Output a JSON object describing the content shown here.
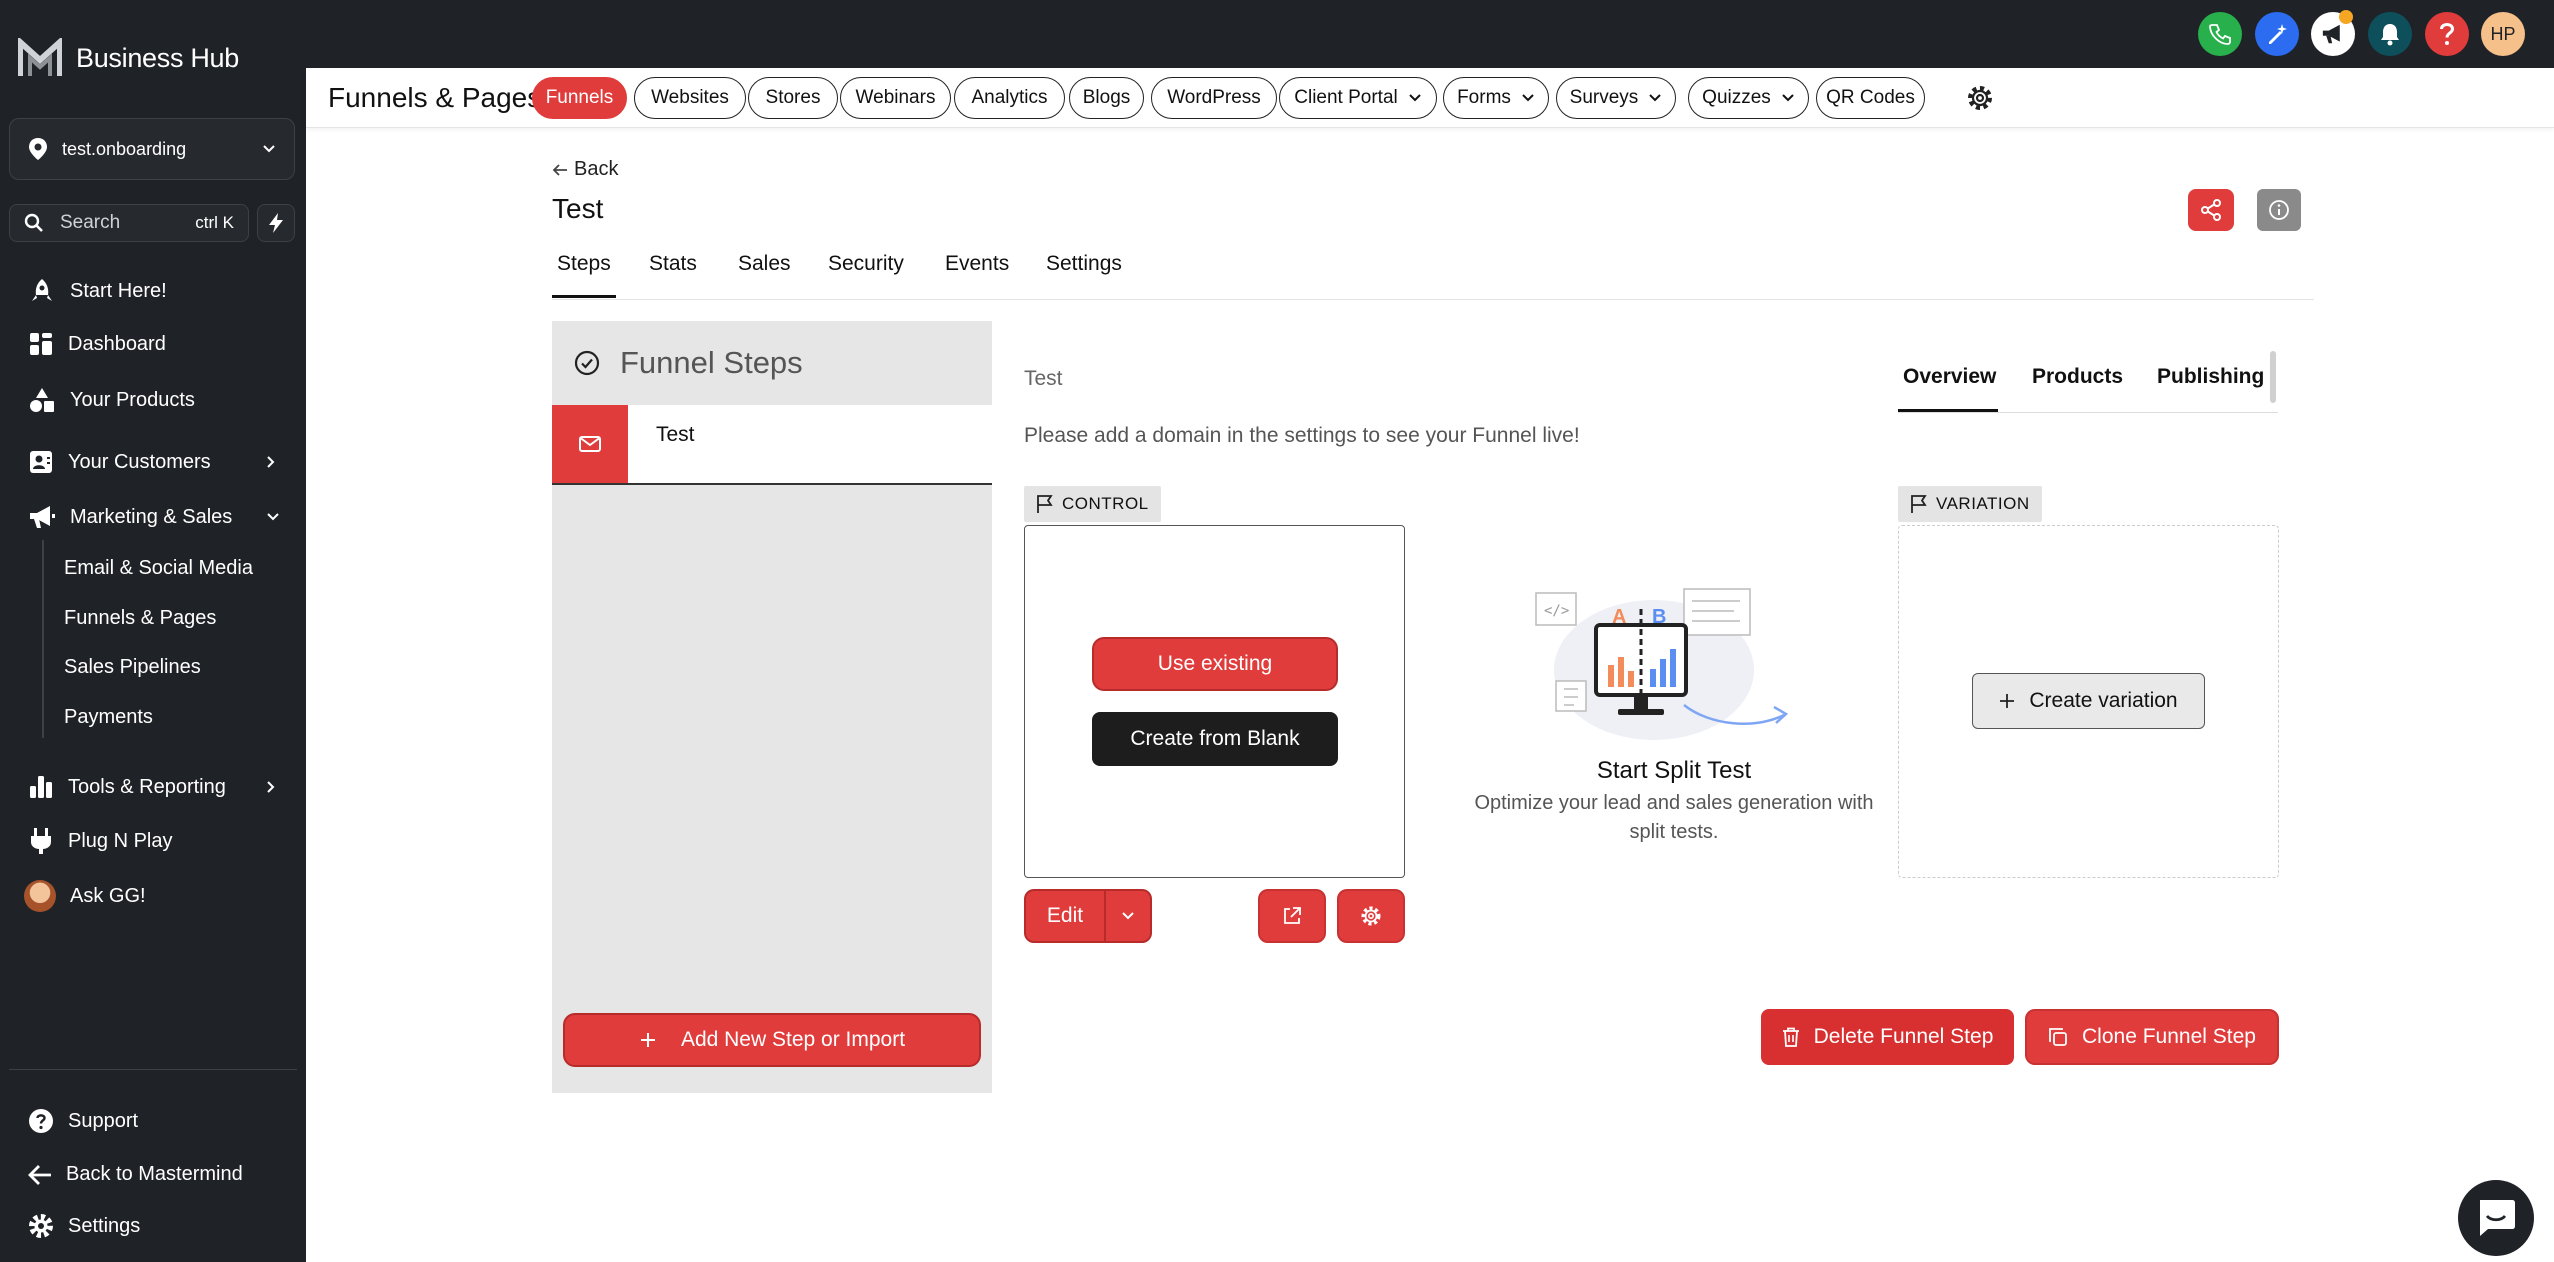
{
  "app": {
    "name": "Business Hub"
  },
  "account": {
    "name": "test.onboarding"
  },
  "search": {
    "placeholder": "Search",
    "shortcut": "ctrl K"
  },
  "sidebar": {
    "items": [
      {
        "label": "Start Here!",
        "icon": "rocket-icon"
      },
      {
        "label": "Dashboard",
        "icon": "dashboard-icon"
      },
      {
        "label": "Your Products",
        "icon": "shapes-icon"
      },
      {
        "label": "Your Customers",
        "icon": "contacts-icon"
      },
      {
        "label": "Marketing & Sales",
        "icon": "megaphone-icon"
      },
      {
        "label": "Tools & Reporting",
        "icon": "bar-chart-icon"
      },
      {
        "label": "Plug N Play",
        "icon": "plug-icon"
      },
      {
        "label": "Ask GG!",
        "icon": "avatar"
      }
    ],
    "sub_items": [
      "Email & Social Media",
      "Funnels & Pages",
      "Sales Pipelines",
      "Payments"
    ],
    "footer": [
      "Support",
      "Back to Mastermind",
      "Settings"
    ]
  },
  "topbar": {
    "user_initials": "HP",
    "accent": "#e03c3c"
  },
  "section": {
    "title": "Funnels & Pages",
    "tabs": [
      "Funnels",
      "Websites",
      "Stores",
      "Webinars",
      "Analytics",
      "Blogs",
      "WordPress",
      "Client Portal",
      "Forms",
      "Surveys",
      "Quizzes",
      "QR Codes"
    ]
  },
  "page": {
    "back_label": "Back",
    "title": "Test",
    "tabs": [
      "Steps",
      "Stats",
      "Sales",
      "Security",
      "Events",
      "Settings"
    ]
  },
  "steps": {
    "header": "Funnel Steps",
    "items": [
      {
        "label": "Test"
      }
    ],
    "add_label": "Add New Step or Import"
  },
  "step_detail": {
    "title": "Test",
    "tabs": [
      "Overview",
      "Products",
      "Publishing"
    ],
    "notice": "Please add a domain in the settings to see your Funnel live!",
    "control_tag": "CONTROL",
    "variation_tag": "VARIATION",
    "use_existing": "Use existing",
    "create_blank": "Create from Blank",
    "edit_label": "Edit",
    "split_title": "Start Split Test",
    "split_desc": "Optimize your lead and sales generation with split tests.",
    "create_variation": "Create variation",
    "delete_label": "Delete Funnel Step",
    "clone_label": "Clone Funnel Step",
    "illustration_letters": [
      "A",
      "B"
    ]
  }
}
